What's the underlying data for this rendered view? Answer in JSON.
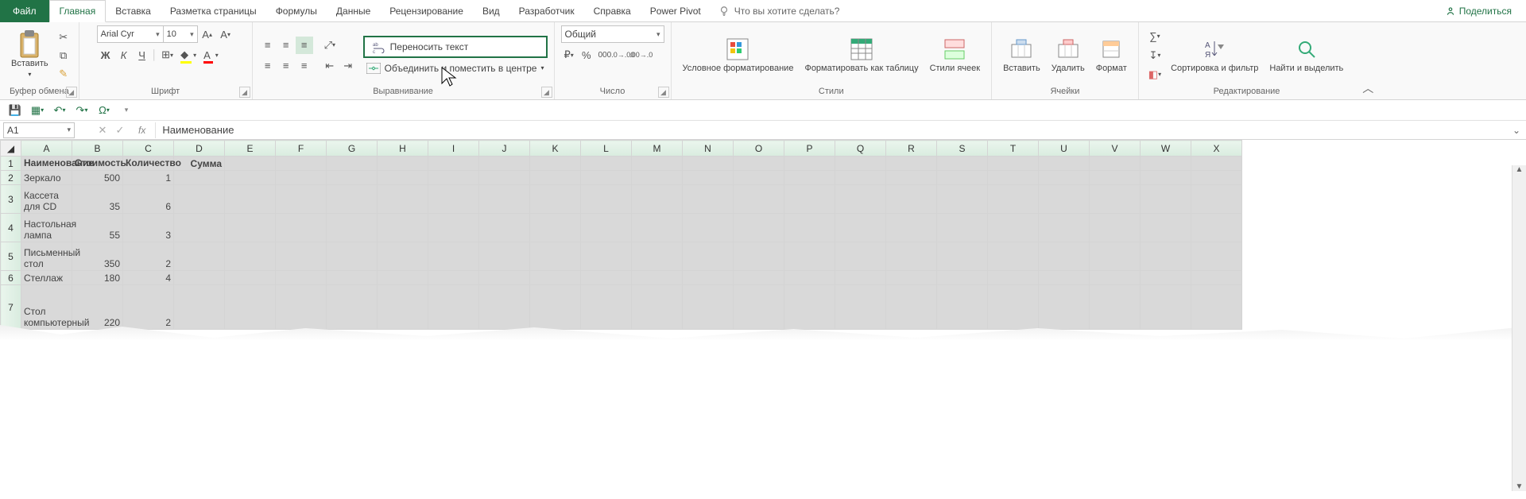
{
  "menu": {
    "file": "Файл",
    "tabs": [
      "Главная",
      "Вставка",
      "Разметка страницы",
      "Формулы",
      "Данные",
      "Рецензирование",
      "Вид",
      "Разработчик",
      "Справка",
      "Power Pivot"
    ],
    "active_index": 0,
    "tell_me": "Что вы хотите сделать?",
    "share": "Поделиться"
  },
  "ribbon": {
    "clipboard": {
      "paste": "Вставить",
      "group_label": "Буфер обмена"
    },
    "font": {
      "name": "Arial Cyr",
      "size": "10",
      "bold": "Ж",
      "italic": "К",
      "underline": "Ч",
      "group_label": "Шрифт"
    },
    "alignment": {
      "wrap_text": "Переносить текст",
      "merge_center": "Объединить и поместить в центре",
      "group_label": "Выравнивание"
    },
    "number": {
      "format": "Общий",
      "group_label": "Число"
    },
    "styles": {
      "cond_fmt": "Условное форматирование",
      "as_table": "Форматировать как таблицу",
      "cell_styles": "Стили ячеек",
      "group_label": "Стили"
    },
    "cells": {
      "insert": "Вставить",
      "delete": "Удалить",
      "format": "Формат",
      "group_label": "Ячейки"
    },
    "editing": {
      "sort_filter": "Сортировка и фильтр",
      "find_select": "Найти и выделить",
      "group_label": "Редактирование"
    }
  },
  "name_box": "A1",
  "formula_value": "Наименование",
  "columns": [
    "A",
    "B",
    "C",
    "D",
    "E",
    "F",
    "G",
    "H",
    "I",
    "J",
    "K",
    "L",
    "M",
    "N",
    "O",
    "P",
    "Q",
    "R",
    "S",
    "T",
    "U",
    "V",
    "W",
    "X"
  ],
  "grid": {
    "headers": {
      "A": "Наименование",
      "B": "Стоимость",
      "C": "Количество",
      "D": "Сумма"
    },
    "rows": [
      {
        "n": "1"
      },
      {
        "n": "2",
        "A": "Зеркало",
        "B": "500",
        "C": "1"
      },
      {
        "n": "3",
        "A": "Кассета для CD",
        "B": "35",
        "C": "6"
      },
      {
        "n": "4",
        "A": "Настольная лампа",
        "B": "55",
        "C": "3"
      },
      {
        "n": "5",
        "A": "Письменный стол",
        "B": "350",
        "C": "2"
      },
      {
        "n": "6",
        "A": "Стеллаж",
        "B": "180",
        "C": "4"
      },
      {
        "n": "7",
        "A": "Стол компьютерный",
        "B": "220",
        "C": "2"
      }
    ]
  },
  "chart_data": {
    "type": "table",
    "columns": [
      "Наименование",
      "Стоимость",
      "Количество",
      "Сумма"
    ],
    "rows": [
      [
        "Зеркало",
        500,
        1,
        null
      ],
      [
        "Кассета для CD",
        35,
        6,
        null
      ],
      [
        "Настольная лампа",
        55,
        3,
        null
      ],
      [
        "Письменный стол",
        350,
        2,
        null
      ],
      [
        "Стеллаж",
        180,
        4,
        null
      ],
      [
        "Стол компьютерный",
        220,
        2,
        null
      ]
    ]
  }
}
